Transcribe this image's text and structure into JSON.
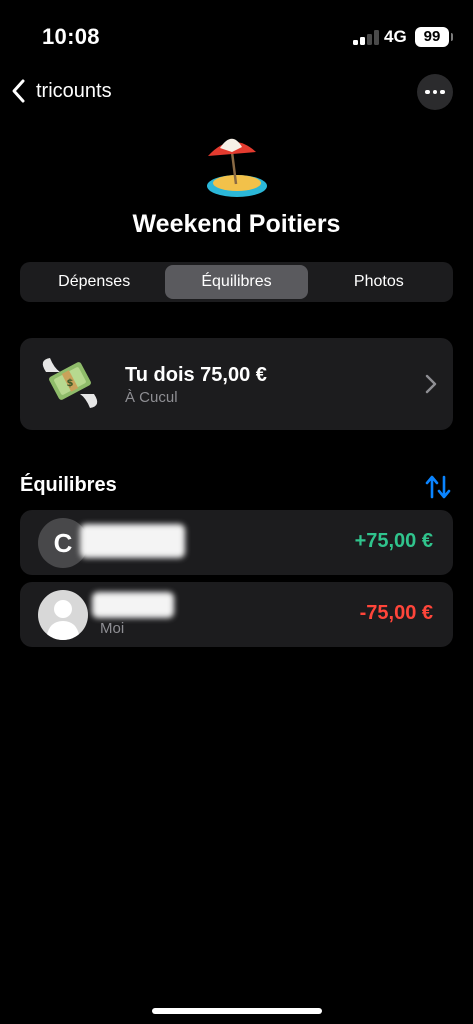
{
  "status_bar": {
    "time": "10:08",
    "network": "4G",
    "battery": "99"
  },
  "nav": {
    "back_label": "tricounts",
    "back_icon": "chevron-left-icon",
    "more_icon": "ellipsis-icon"
  },
  "group": {
    "emoji": "beach-with-umbrella-icon",
    "title": "Weekend Poitiers"
  },
  "tabs": [
    {
      "label": "Dépenses",
      "active": false
    },
    {
      "label": "Équilibres",
      "active": true
    },
    {
      "label": "Photos",
      "active": false
    }
  ],
  "debt_card": {
    "icon": "money-with-wings-icon",
    "title": "Tu dois 75,00 €",
    "subtitle": "À Cucul"
  },
  "balances": {
    "section_title": "Équilibres",
    "sort_icon": "sort-arrows-icon",
    "members": [
      {
        "avatar_letter": "C",
        "subtitle": "",
        "amount": "+75,00 €"
      },
      {
        "avatar_letter": "",
        "subtitle": "Moi",
        "amount": "-75,00 €"
      }
    ]
  },
  "colors": {
    "background": "#000000",
    "card": "#1c1c1e",
    "positive": "#30c48d",
    "negative": "#ff453a",
    "accent": "#0a84ff",
    "secondary_text": "#8e8e93"
  }
}
